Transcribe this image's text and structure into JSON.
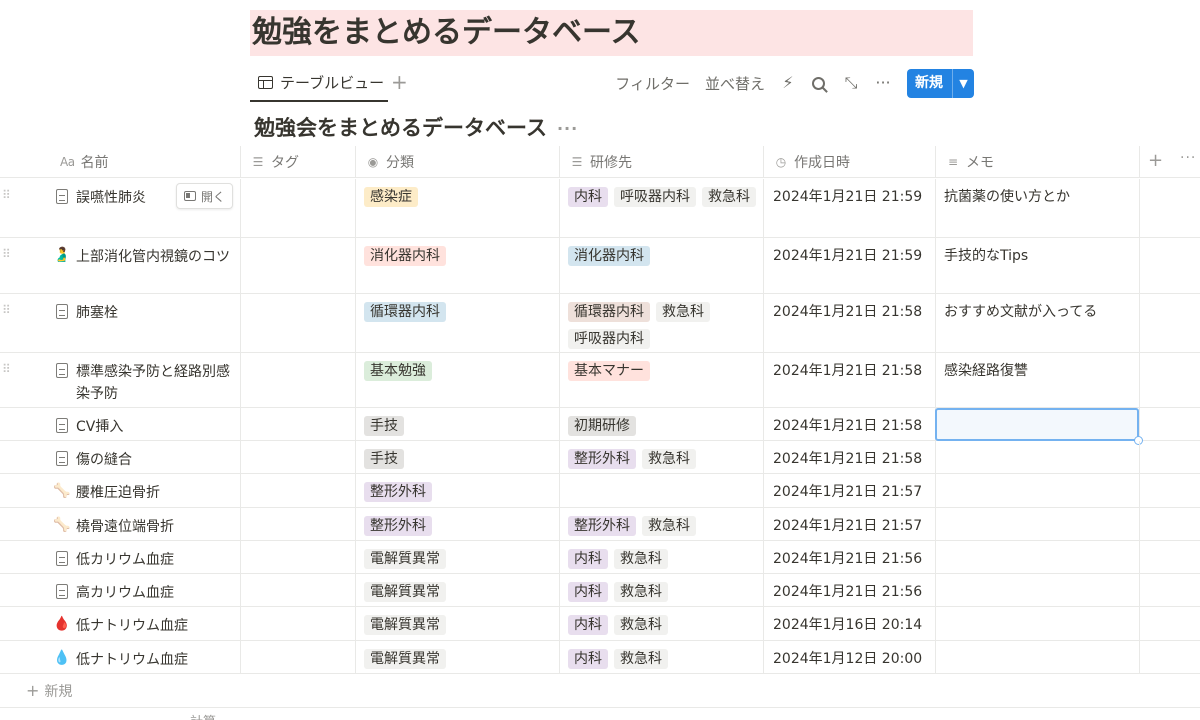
{
  "page": {
    "title": "勉強をまとめるデータベース"
  },
  "view": {
    "tab_label": "テーブルビュー",
    "add_view": "+"
  },
  "toolbar": {
    "filter_label": "フィルター",
    "sort_label": "並べ替え",
    "new_label": "新規",
    "icons": [
      "lightning-icon",
      "search-icon",
      "expand-icon",
      "more-icon"
    ]
  },
  "database": {
    "title": "勉強会をまとめるデータベース"
  },
  "columns": {
    "name": "名前",
    "name_icon": "Aa",
    "tag": "タグ",
    "category": "分類",
    "training": "研修先",
    "created": "作成日時",
    "memo": "メモ"
  },
  "open_button_label": "開く",
  "tag_colors": {
    "yellow": "#fdecc8",
    "red": "#ffe2dd",
    "blue": "#d3e5ef",
    "green": "#dbeddb",
    "gray": "#e3e2e0",
    "purple": "#e8deee",
    "brown": "#eee0da",
    "light_gray": "#f1f1ef"
  },
  "rows": [
    {
      "icon": "doc",
      "name": "誤嚥性肺炎",
      "category": {
        "label": "感染症",
        "color": "yellow"
      },
      "training": [
        {
          "label": "内科",
          "color": "purple"
        },
        {
          "label": "呼吸器内科",
          "color": "light_gray"
        },
        {
          "label": "救急科",
          "color": "light_gray"
        }
      ],
      "created": "2024年1月21日 21:59",
      "memo": "抗菌薬の使い方とか"
    },
    {
      "icon": "stomach",
      "name": "上部消化管内視鏡のコツ",
      "category": {
        "label": "消化器内科",
        "color": "red"
      },
      "training": [
        {
          "label": "消化器内科",
          "color": "blue"
        }
      ],
      "created": "2024年1月21日 21:59",
      "memo": "手技的なTips"
    },
    {
      "icon": "doc",
      "name": "肺塞栓",
      "category": {
        "label": "循環器内科",
        "color": "blue"
      },
      "training": [
        {
          "label": "循環器内科",
          "color": "brown"
        },
        {
          "label": "救急科",
          "color": "light_gray"
        },
        {
          "label": "呼吸器内科",
          "color": "light_gray"
        }
      ],
      "created": "2024年1月21日 21:58",
      "memo": "おすすめ文献が入ってる"
    },
    {
      "icon": "doc",
      "name": "標準感染予防と経路別感染予防",
      "category": {
        "label": "基本勉強",
        "color": "green"
      },
      "training": [
        {
          "label": "基本マナー",
          "color": "red"
        }
      ],
      "created": "2024年1月21日 21:58",
      "memo": "感染経路復讐"
    },
    {
      "icon": "doc",
      "name": "CV挿入",
      "category": {
        "label": "手技",
        "color": "gray"
      },
      "training": [
        {
          "label": "初期研修",
          "color": "gray"
        }
      ],
      "created": "2024年1月21日 21:58",
      "memo": ""
    },
    {
      "icon": "doc",
      "name": "傷の縫合",
      "category": {
        "label": "手技",
        "color": "gray"
      },
      "training": [
        {
          "label": "整形外科",
          "color": "purple"
        },
        {
          "label": "救急科",
          "color": "light_gray"
        }
      ],
      "created": "2024年1月21日 21:58",
      "memo": ""
    },
    {
      "icon": "spine",
      "name": "腰椎圧迫骨折",
      "category": {
        "label": "整形外科",
        "color": "purple"
      },
      "training": [],
      "created": "2024年1月21日 21:57",
      "memo": ""
    },
    {
      "icon": "bone",
      "name": "橈骨遠位端骨折",
      "category": {
        "label": "整形外科",
        "color": "purple"
      },
      "training": [
        {
          "label": "整形外科",
          "color": "purple"
        },
        {
          "label": "救急科",
          "color": "light_gray"
        }
      ],
      "created": "2024年1月21日 21:57",
      "memo": ""
    },
    {
      "icon": "doc",
      "name": "低カリウム血症",
      "category": {
        "label": "電解質異常",
        "color": "light_gray"
      },
      "training": [
        {
          "label": "内科",
          "color": "purple"
        },
        {
          "label": "救急科",
          "color": "light_gray"
        }
      ],
      "created": "2024年1月21日 21:56",
      "memo": ""
    },
    {
      "icon": "doc",
      "name": "高カリウム血症",
      "category": {
        "label": "電解質異常",
        "color": "light_gray"
      },
      "training": [
        {
          "label": "内科",
          "color": "purple"
        },
        {
          "label": "救急科",
          "color": "light_gray"
        }
      ],
      "created": "2024年1月21日 21:56",
      "memo": ""
    },
    {
      "icon": "drop-red",
      "name": "低ナトリウム血症",
      "category": {
        "label": "電解質異常",
        "color": "light_gray"
      },
      "training": [
        {
          "label": "内科",
          "color": "purple"
        },
        {
          "label": "救急科",
          "color": "light_gray"
        }
      ],
      "created": "2024年1月16日 20:14",
      "memo": ""
    },
    {
      "icon": "drop-blue",
      "name": "低ナトリウム血症",
      "category": {
        "label": "電解質異常",
        "color": "light_gray"
      },
      "training": [
        {
          "label": "内科",
          "color": "purple"
        },
        {
          "label": "救急科",
          "color": "light_gray"
        }
      ],
      "created": "2024年1月12日 20:00",
      "memo": ""
    }
  ],
  "footer": {
    "new_row_label": "新規",
    "calc_label": "計算"
  }
}
